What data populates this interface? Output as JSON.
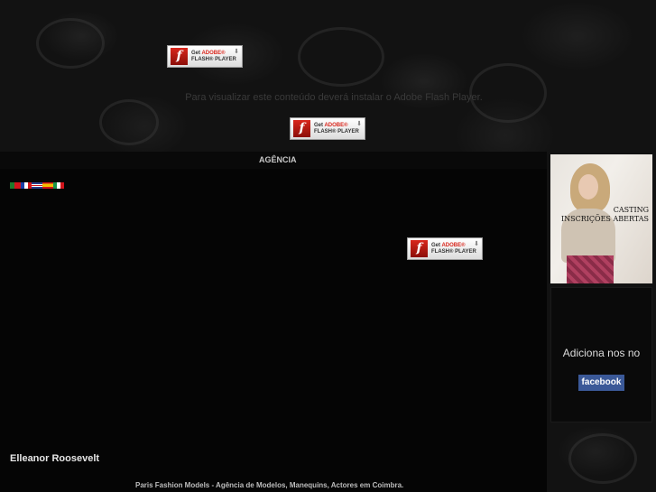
{
  "header": {
    "faded_title": "",
    "warning_text": "Para visualizar este conteúdo deverá instalar o Adobe Flash Player."
  },
  "flash_badge": {
    "get_label": "Get",
    "brand_label": "ADOBE®",
    "product_label": "FLASH® PLAYER"
  },
  "nav": {
    "item_agencia": "AGÊNCIA"
  },
  "flags": [
    {
      "name": "portugal-flag-icon",
      "color": "#1e7a2c"
    },
    {
      "name": "france-flag-icon",
      "color": "#1b3fa6"
    },
    {
      "name": "uk-flag-icon",
      "color": "#2a3f8a"
    },
    {
      "name": "spain-flag-icon",
      "color": "#d1141b"
    },
    {
      "name": "italy-flag-icon",
      "color": "#19924a"
    }
  ],
  "casting_banner": {
    "line1": "CASTING",
    "line2": "INSCRIÇÕES ABERTAS"
  },
  "facebook": {
    "text": "Adiciona nos no",
    "button": "facebook",
    "color": "#3b5998"
  },
  "quote_author": "Elleanor Roosevelt",
  "footer": {
    "text": "Paris Fashion Models - Agência de Modelos, Manequins, Actores em Coimbra."
  }
}
